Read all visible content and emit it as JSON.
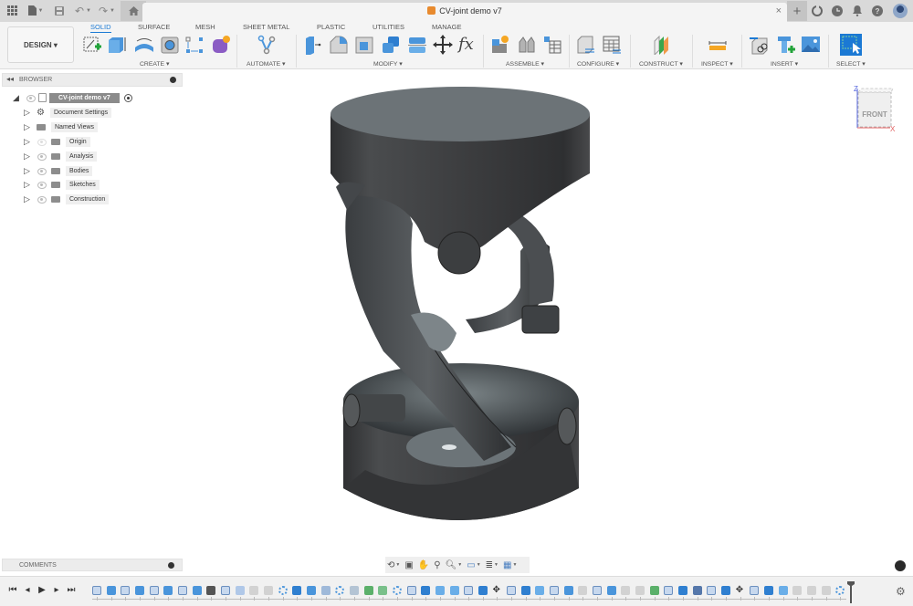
{
  "titlebar": {
    "icons": [
      "apps-grid-icon",
      "file-icon",
      "save-icon",
      "undo-icon",
      "redo-icon",
      "home-icon"
    ],
    "document_title": "CV-joint demo v7",
    "close_tab": "×",
    "new_tab": "+",
    "right_icons": [
      "extensions-icon",
      "job-status-icon",
      "notifications-icon",
      "help-icon",
      "user-avatar"
    ]
  },
  "ribbon": {
    "workspace": "DESIGN ▾",
    "tabs": [
      {
        "label": "SOLID",
        "active": true
      },
      {
        "label": "SURFACE",
        "active": false
      },
      {
        "label": "MESH",
        "active": false
      },
      {
        "label": "SHEET METAL",
        "active": false
      },
      {
        "label": "PLASTIC",
        "active": false
      },
      {
        "label": "UTILITIES",
        "active": false
      },
      {
        "label": "MANAGE",
        "active": false
      }
    ],
    "groups": [
      {
        "label": "CREATE ▾",
        "tools": [
          "create-sketch",
          "extrude",
          "revolve",
          "hole",
          "pattern",
          "form"
        ]
      },
      {
        "label": "AUTOMATE ▾",
        "tools": [
          "automated-modeling"
        ]
      },
      {
        "label": "MODIFY ▾",
        "tools": [
          "press-pull",
          "fillet",
          "shell",
          "combine",
          "split-body",
          "move-copy",
          "parameters"
        ]
      },
      {
        "label": "ASSEMBLE ▾",
        "tools": [
          "new-component",
          "joint",
          "bill-of-materials"
        ]
      },
      {
        "label": "CONFIGURE ▾",
        "tools": [
          "configure-design",
          "configuration-table"
        ]
      },
      {
        "label": "CONSTRUCT ▾",
        "tools": [
          "offset-plane"
        ]
      },
      {
        "label": "INSPECT ▾",
        "tools": [
          "measure"
        ]
      },
      {
        "label": "INSERT ▾",
        "tools": [
          "insert-derive",
          "insert-mcmaster",
          "insert-canvas"
        ]
      },
      {
        "label": "SELECT ▾",
        "tools": [
          "select"
        ]
      }
    ]
  },
  "browser": {
    "title": "BROWSER",
    "root": "CV-joint demo v7",
    "items": [
      {
        "label": "Document Settings",
        "icon": "gear",
        "eye": "none"
      },
      {
        "label": "Named Views",
        "icon": "folder",
        "eye": "none"
      },
      {
        "label": "Origin",
        "icon": "folder",
        "eye": "hidden"
      },
      {
        "label": "Analysis",
        "icon": "folder",
        "eye": "visible"
      },
      {
        "label": "Bodies",
        "icon": "folder",
        "eye": "visible"
      },
      {
        "label": "Sketches",
        "icon": "folder",
        "eye": "visible"
      },
      {
        "label": "Construction",
        "icon": "folder",
        "eye": "visible"
      }
    ]
  },
  "viewcube": {
    "face": "FRONT",
    "axis_z": "Z",
    "axis_x": "X"
  },
  "comments": {
    "title": "COMMENTS"
  },
  "navbar": {
    "tools": [
      "orbit-icon",
      "look-at-icon",
      "pan-icon",
      "zoom-icon",
      "zoom-window-icon",
      "display-settings-icon",
      "grid-settings-icon",
      "viewports-icon"
    ]
  },
  "timeline": {
    "controls": [
      "go-to-start",
      "step-back",
      "play",
      "step-forward",
      "go-to-end"
    ],
    "steps": [
      "sketch",
      "extrude",
      "sketch",
      "extrude",
      "sketch",
      "extrude",
      "sketch",
      "split",
      "joint",
      "sketch",
      "plane",
      "fillet",
      "fillet",
      "pattern",
      "combine",
      "extrude",
      "box",
      "pattern",
      "chamfer",
      "construct",
      "offset",
      "pattern",
      "sketch",
      "body",
      "shell",
      "shell",
      "sketch",
      "body",
      "move",
      "sketch",
      "body",
      "shell",
      "sketch",
      "extrude",
      "fillet",
      "sketch",
      "extrude",
      "fillet",
      "fillet",
      "construct",
      "sketch",
      "body",
      "draft",
      "sketch",
      "body",
      "move",
      "sketch",
      "body",
      "shell",
      "fillet",
      "fillet",
      "fillet",
      "pattern"
    ]
  },
  "colors": {
    "accent": "#1b79d4",
    "toolbar_bg": "#f4f4f4",
    "titlebar_bg": "#d9d9d9",
    "model_dark": "#3c3d3f",
    "model_top": "#6f7679"
  }
}
